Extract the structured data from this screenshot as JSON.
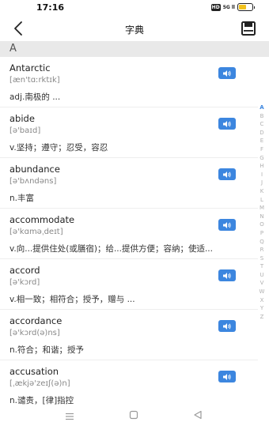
{
  "status": {
    "time": "17:16",
    "hd": "HD",
    "signal": "5G ll"
  },
  "header": {
    "title": "字典"
  },
  "section": {
    "letter": "A"
  },
  "words": [
    {
      "word": "Antarctic",
      "phonetic": "[æn'tɑːrktɪk]",
      "meaning": "adj.南极的 ..."
    },
    {
      "word": "abide",
      "phonetic": "[ə'baɪd]",
      "meaning": "v.坚持；遵守；忍受，容忍"
    },
    {
      "word": "abundance",
      "phonetic": "[ə'bʌndəns]",
      "meaning": "n.丰富"
    },
    {
      "word": "accommodate",
      "phonetic": "[ə'kɑməˌdeɪt]",
      "meaning": "v.向...提供住处(或膳宿)；给...提供方便；容纳；使适..."
    },
    {
      "word": "accord",
      "phonetic": "[ə'kɔrd]",
      "meaning": "v.相一致；相符合；授予，赠与 ..."
    },
    {
      "word": "accordance",
      "phonetic": "[ə'kɔrd(ə)ns]",
      "meaning": "n.符合；和谐；授予"
    },
    {
      "word": "accusation",
      "phonetic": "[ˌækjə'zeɪʃ(ə)n]",
      "meaning": "n.谴责，[律]指控"
    }
  ],
  "index_letters": [
    "A",
    "B",
    "C",
    "D",
    "E",
    "F",
    "G",
    "H",
    "I",
    "J",
    "K",
    "L",
    "M",
    "N",
    "O",
    "P",
    "Q",
    "R",
    "S",
    "T",
    "U",
    "V",
    "W",
    "X",
    "Y",
    "Z"
  ],
  "colors": {
    "accent": "#3c86df",
    "battery": "#f2c21d"
  },
  "icons": {
    "back": "chevron-left-icon",
    "save": "save-icon",
    "speaker": "speaker-icon"
  }
}
